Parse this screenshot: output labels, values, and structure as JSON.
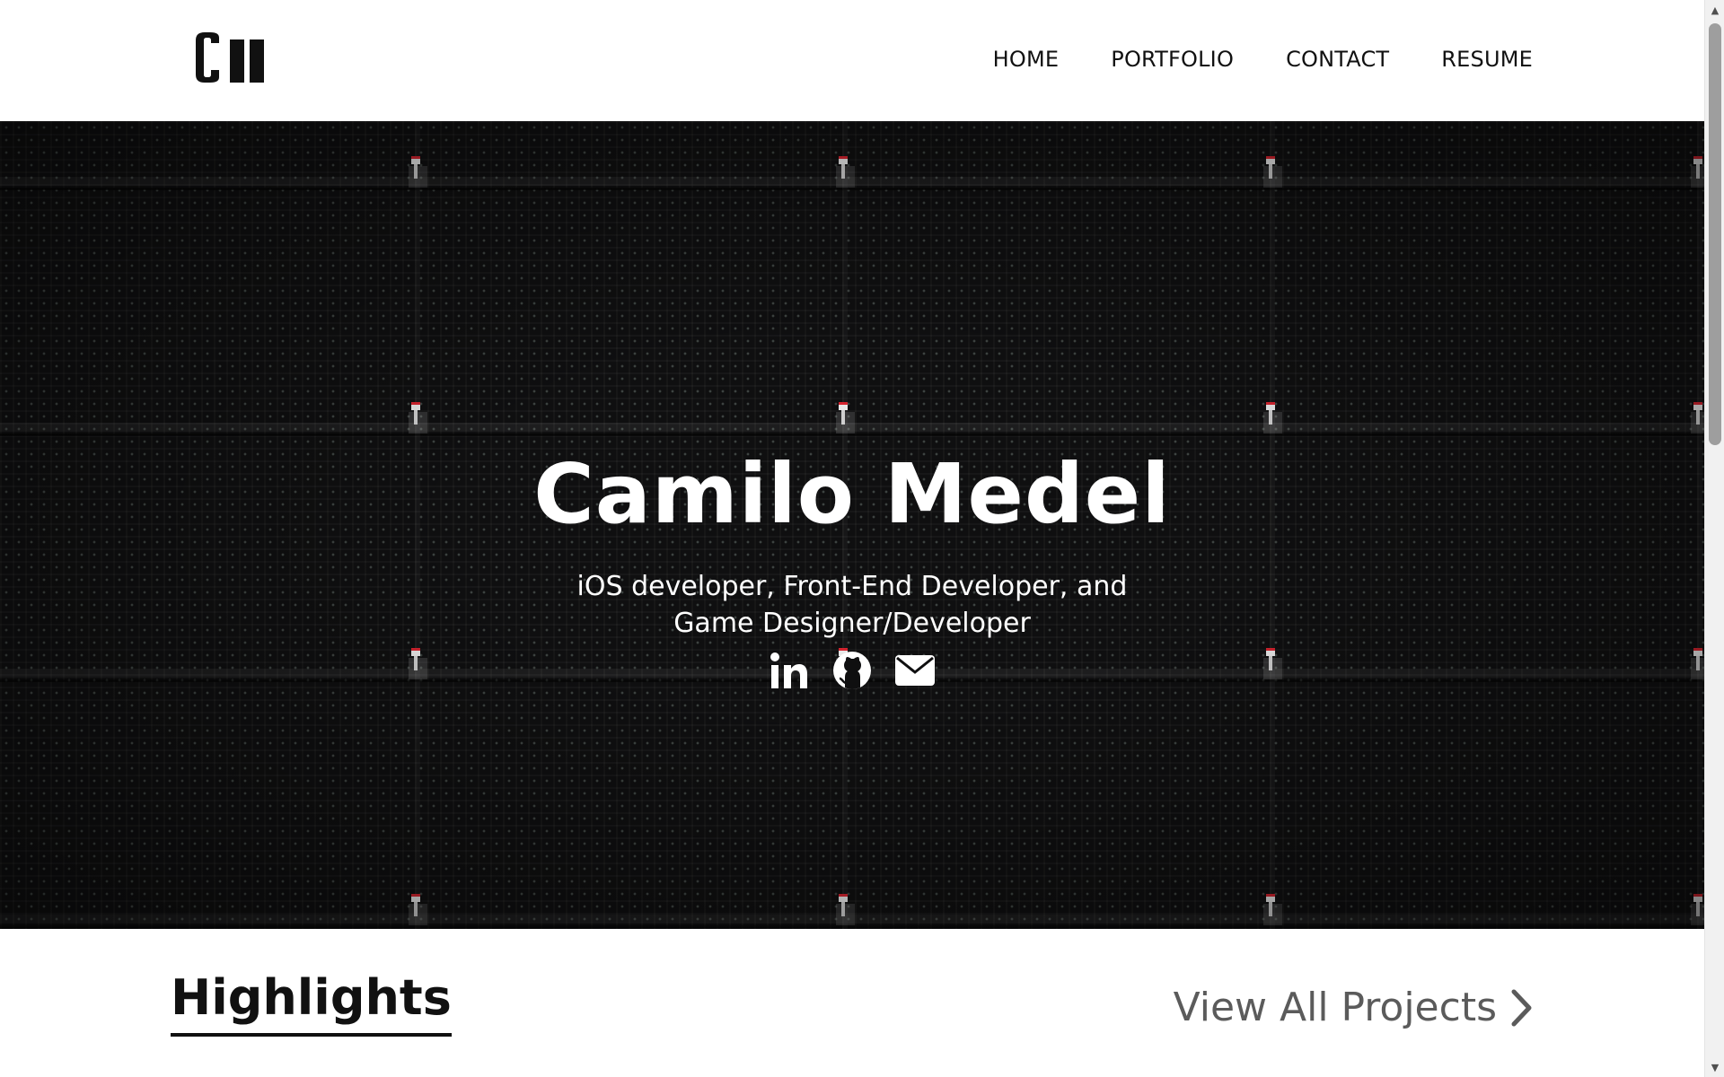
{
  "header": {
    "logo_alt": "CM logo",
    "nav": [
      {
        "label": "HOME"
      },
      {
        "label": "PORTFOLIO"
      },
      {
        "label": "CONTACT"
      },
      {
        "label": "RESUME"
      }
    ]
  },
  "hero": {
    "title": "Camilo Medel",
    "subtitle": "iOS developer, Front-End Developer, and Game Designer/Developer",
    "social": [
      {
        "icon": "linkedin-icon"
      },
      {
        "icon": "github-icon"
      },
      {
        "icon": "envelope-icon"
      }
    ]
  },
  "highlights": {
    "title": "Highlights",
    "view_all_label": "View All Projects"
  },
  "colors": {
    "hero_background": "#0f0f10",
    "text_dark": "#111111",
    "link_gray": "#5b5b5b",
    "white": "#ffffff",
    "light_red": "#d4242f"
  }
}
